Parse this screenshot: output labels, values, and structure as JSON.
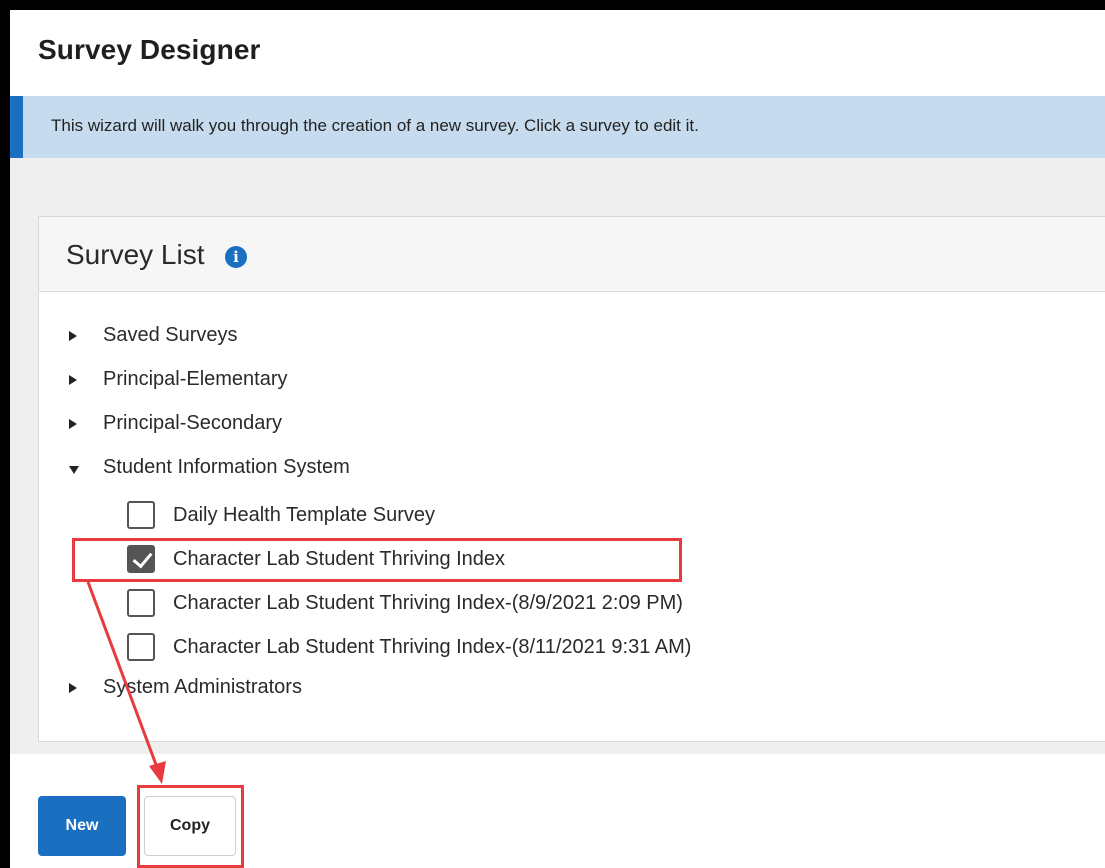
{
  "header": {
    "title": "Survey Designer"
  },
  "banner": {
    "text": "This wizard will walk you through the creation of a new survey. Click a survey to edit it."
  },
  "survey_list": {
    "title": "Survey List",
    "info_icon": "i",
    "groups": [
      {
        "label": "Saved Surveys",
        "expanded": false
      },
      {
        "label": "Principal-Elementary",
        "expanded": false
      },
      {
        "label": "Principal-Secondary",
        "expanded": false
      },
      {
        "label": "Student Information System",
        "expanded": true
      },
      {
        "label": "System Administrators",
        "expanded": false
      }
    ],
    "surveys": [
      {
        "label": "Daily Health Template Survey",
        "checked": false
      },
      {
        "label": "Character Lab Student Thriving Index",
        "checked": true
      },
      {
        "label": "Character Lab Student Thriving Index-(8/9/2021 2:09 PM)",
        "checked": false
      },
      {
        "label": "Character Lab Student Thriving Index-(8/11/2021 9:31 AM)",
        "checked": false
      }
    ]
  },
  "actions": {
    "new_label": "New",
    "copy_label": "Copy"
  },
  "colors": {
    "accent": "#1a6fc0",
    "banner_bg": "#c6dcee",
    "annotation": "#e83a3f"
  }
}
